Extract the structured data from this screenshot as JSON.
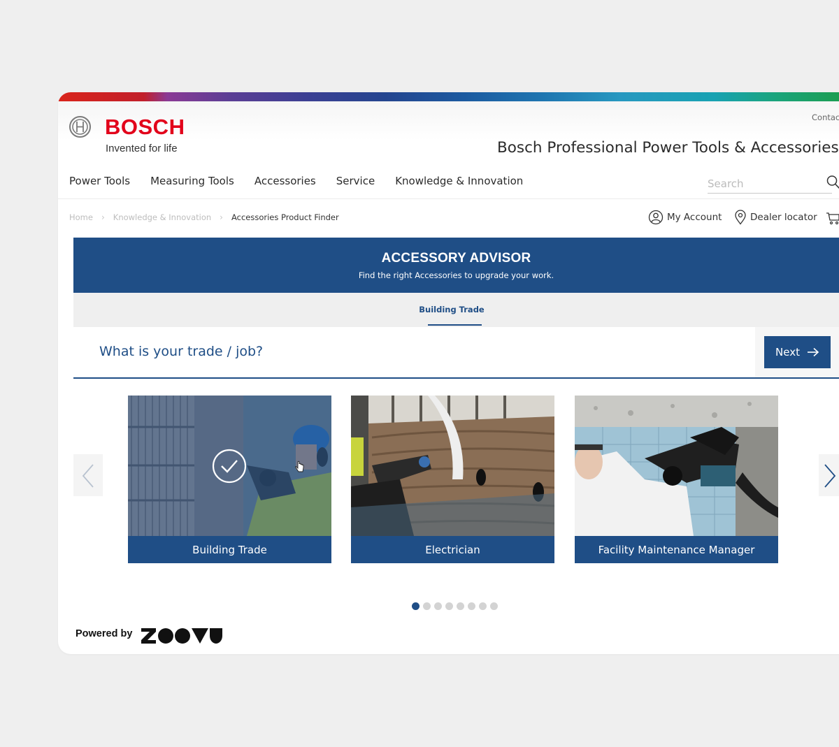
{
  "brand": {
    "name": "BOSCH",
    "tagline": "Invented for life",
    "brand_color": "#e2001a"
  },
  "header": {
    "contact_label": "Contac",
    "site_title": "Bosch Professional Power Tools & Accessories"
  },
  "nav": {
    "items": [
      {
        "label": "Power Tools"
      },
      {
        "label": "Measuring Tools"
      },
      {
        "label": "Accessories"
      },
      {
        "label": "Service"
      },
      {
        "label": "Knowledge & Innovation"
      }
    ]
  },
  "search": {
    "placeholder": "Search",
    "value": "",
    "icon": "search-icon"
  },
  "breadcrumb": {
    "items": [
      {
        "label": "Home"
      },
      {
        "label": "Knowledge & Innovation"
      },
      {
        "label": "Accessories Product Finder"
      }
    ]
  },
  "utility": {
    "account_label": "My Account",
    "dealer_label": "Dealer locator",
    "cart_icon": "cart-icon"
  },
  "advisor": {
    "title": "ACCESSORY ADVISOR",
    "subtitle": "Find the right Accessories to upgrade your work.",
    "active_step": "Building Trade",
    "question": "What is your trade / job?",
    "next_label": "Next",
    "accent_color": "#1f4e86"
  },
  "cards": [
    {
      "label": "Building Trade",
      "selected": true
    },
    {
      "label": "Electrician",
      "selected": false
    },
    {
      "label": "Facility Maintenance Manager",
      "selected": false
    }
  ],
  "pagination": {
    "total": 8,
    "active_index": 0
  },
  "footer": {
    "powered_by": "Powered by",
    "partner": "ZOOVU"
  }
}
